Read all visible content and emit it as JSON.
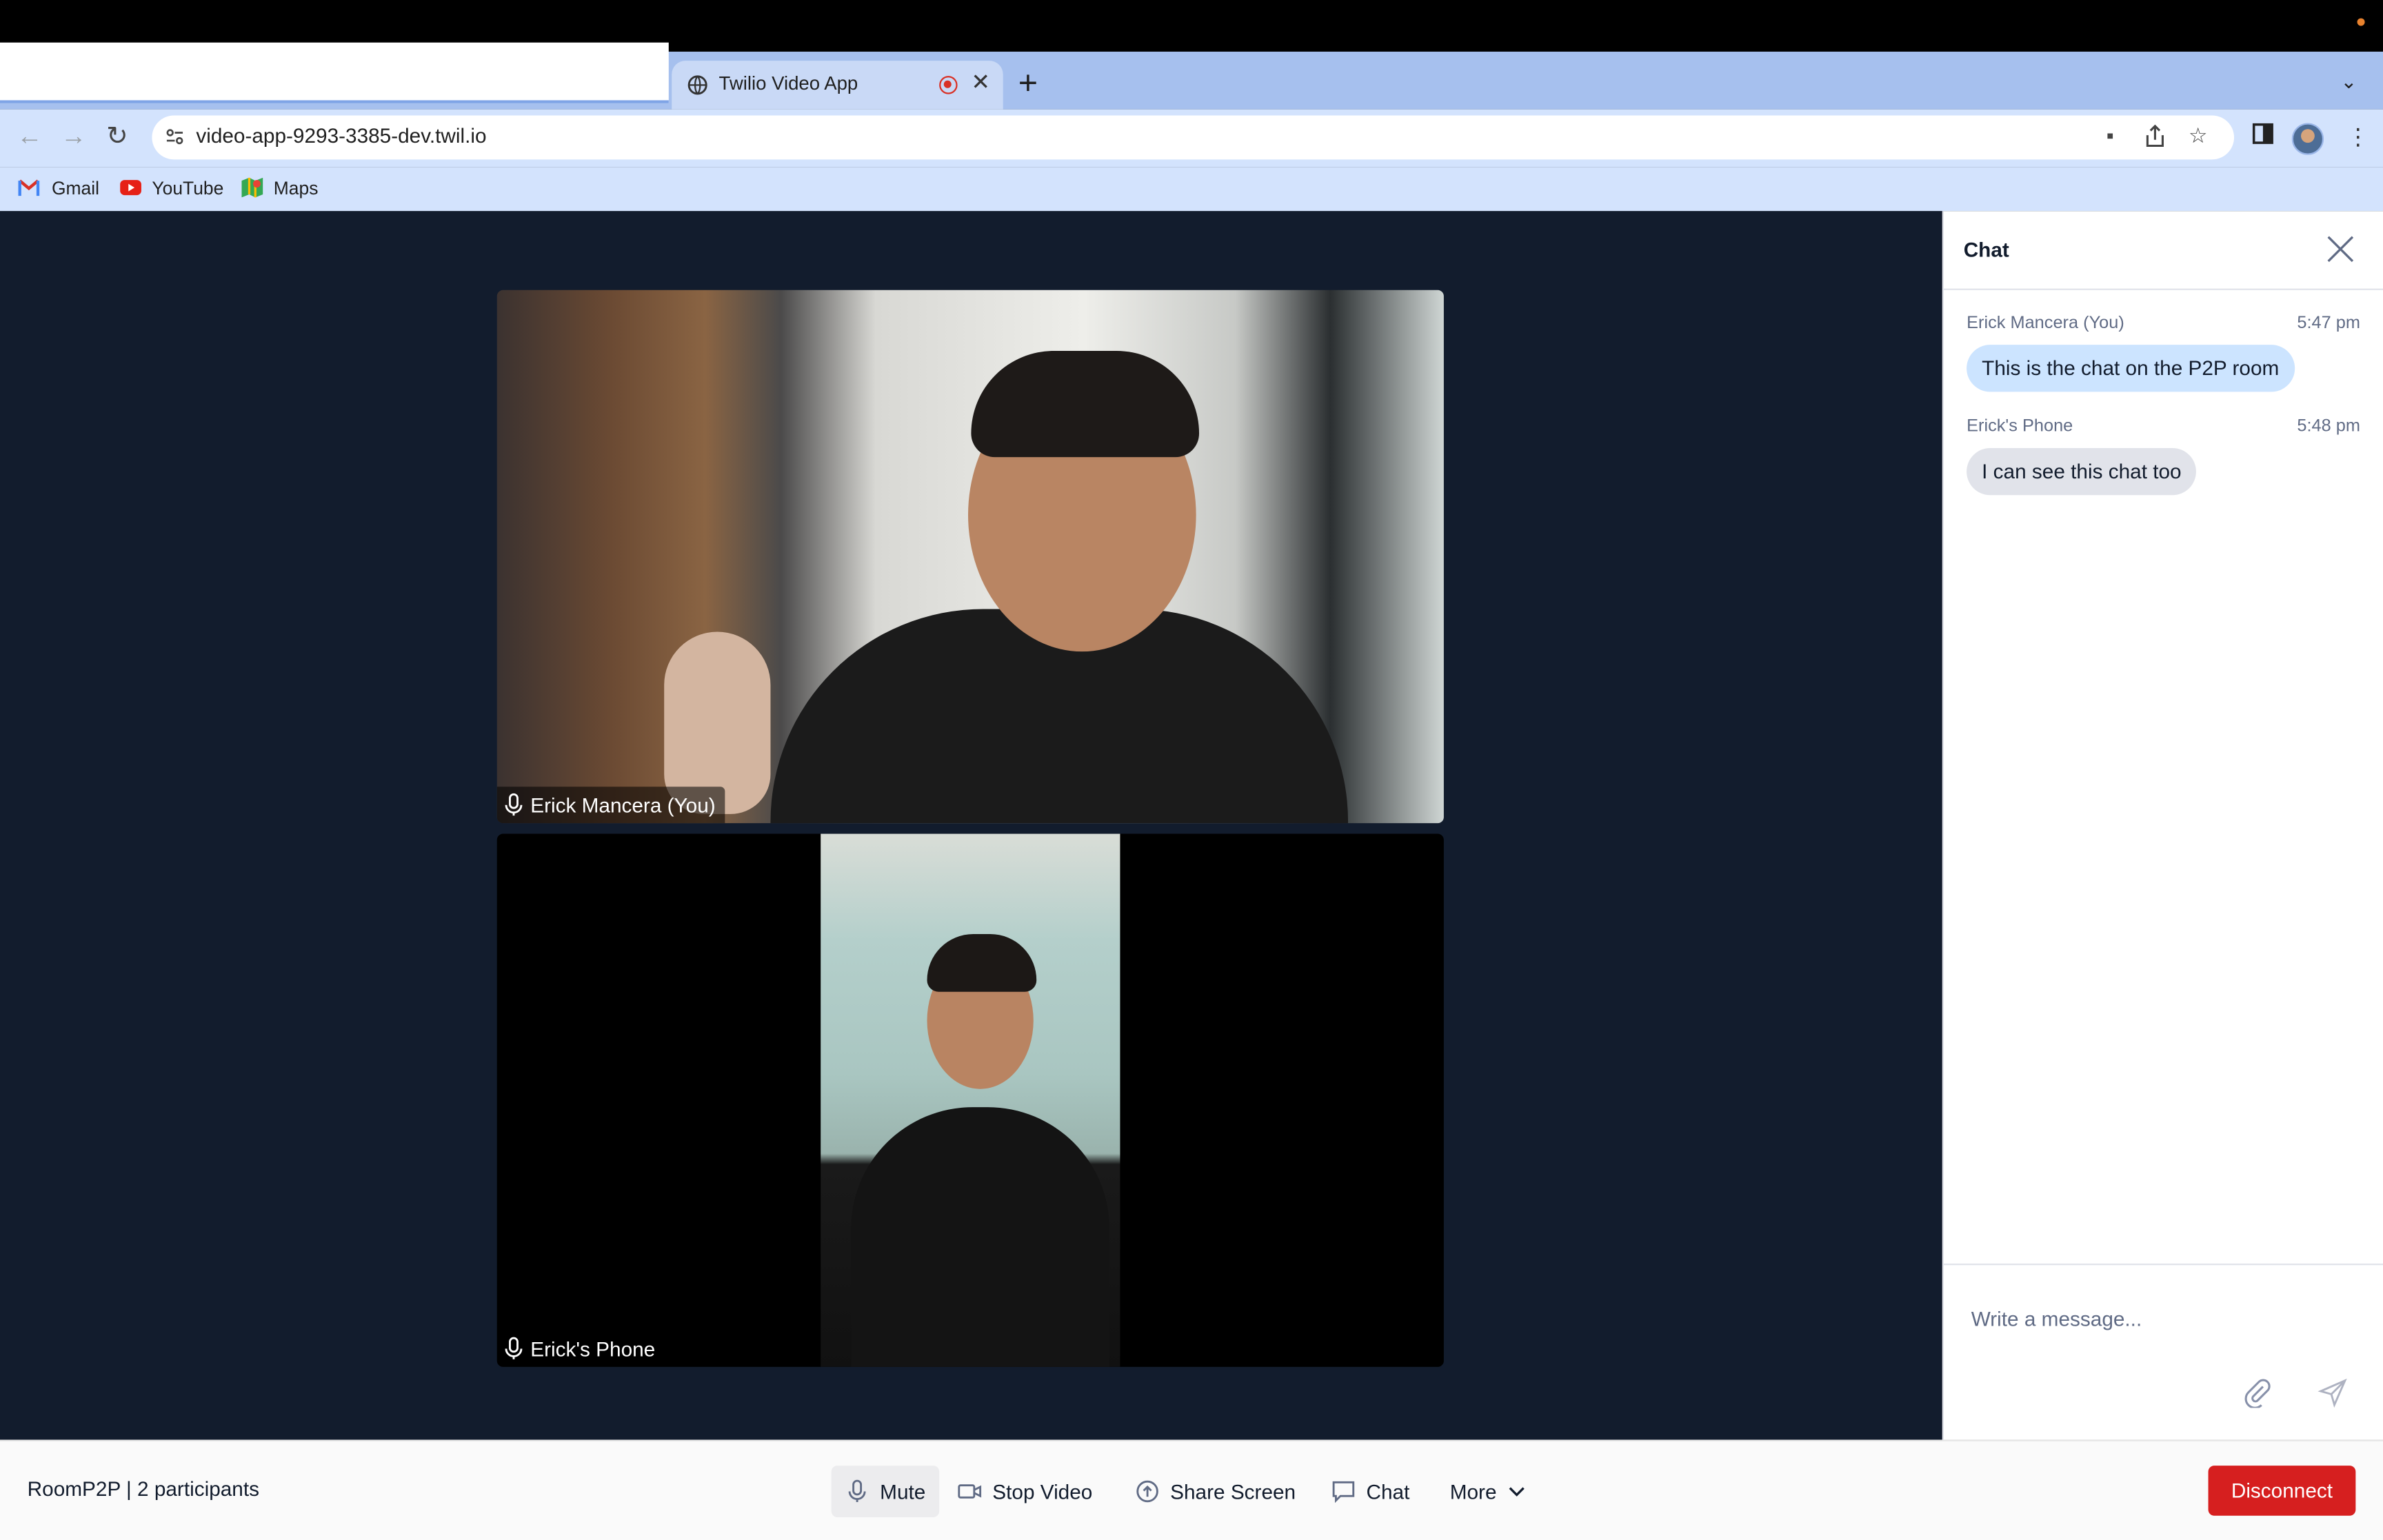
{
  "browser": {
    "tab_title": "Twilio Video App",
    "url": "video-app-9293-3385-dev.twil.io",
    "bookmarks": [
      "Gmail",
      "YouTube",
      "Maps"
    ]
  },
  "participants": [
    {
      "name": "Erick Mancera (You)"
    },
    {
      "name": "Erick's Phone"
    }
  ],
  "chat": {
    "title": "Chat",
    "messages": [
      {
        "author": "Erick Mancera (You)",
        "time": "5:47 pm",
        "text": "This is the chat on the P2P room"
      },
      {
        "author": "Erick's Phone",
        "time": "5:48 pm",
        "text": "I can see this chat too"
      }
    ],
    "input_placeholder": "Write a message..."
  },
  "footer": {
    "room_info": "RoomP2P | 2 participants",
    "mute_label": "Mute",
    "stop_video_label": "Stop Video",
    "share_screen_label": "Share Screen",
    "chat_label": "Chat",
    "more_label": "More",
    "disconnect_label": "Disconnect"
  },
  "colors": {
    "stage_bg": "#121c2d",
    "disconnect": "#d61f1f",
    "my_bubble": "#cce4ff",
    "other_bubble": "#e1e3ea"
  }
}
